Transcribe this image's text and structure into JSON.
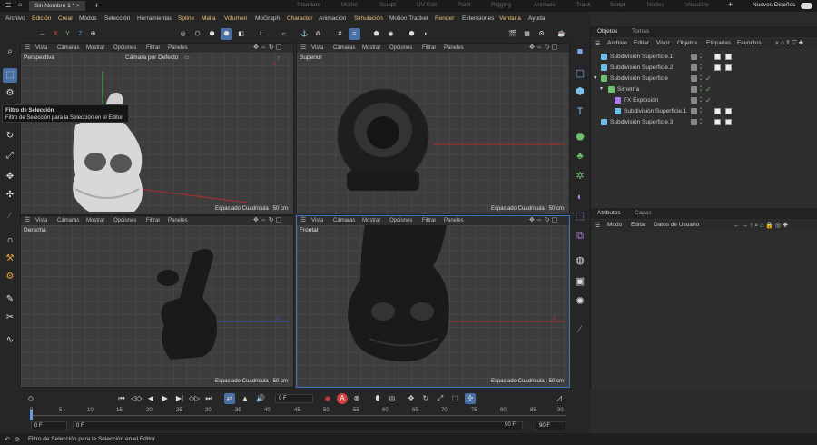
{
  "topbar": {
    "file_tab": "Sin Nombre 1 *",
    "layouts": [
      "Standard",
      "Model",
      "Sculpt",
      "UV Edit",
      "Paint",
      "Rigging",
      "Animate",
      "Track",
      "Script",
      "Nodes",
      "Visualize"
    ],
    "new_layouts": "Nuevos Diseños"
  },
  "menu": [
    "Archivo",
    "Edición",
    "Crear",
    "Modos",
    "Selección",
    "Herramientas",
    "Spline",
    "Malla",
    "Volumen",
    "MoGraph",
    "Character",
    "Animación",
    "Simulación",
    "Motion Tracker",
    "Render",
    "Extensiones",
    "Ventana",
    "Ayuda"
  ],
  "toolbar": {
    "x": "X",
    "y": "Y",
    "z": "Z"
  },
  "tooltip": {
    "title": "Filtro de Selección",
    "desc": "Filtro de Selección para la Selección en el Editor"
  },
  "viewport_menu": [
    "Vista",
    "Cámaras",
    "Mostrar",
    "Opciones",
    "Filtrar",
    "Paneles"
  ],
  "viewports": {
    "perspective": {
      "label": "Perspectiva",
      "camera": "Cámara por Defecto",
      "grid": "Espaciado Cuadrícula : 50 cm"
    },
    "top": {
      "label": "Superior",
      "grid": "Espaciado Cuadrícula : 50 cm"
    },
    "right": {
      "label": "Derecha",
      "grid": "Espaciado Cuadrícula : 50 cm"
    },
    "front": {
      "label": "Frontal",
      "grid": "Espaciado Cuadrícula : 50 cm"
    }
  },
  "objects_panel": {
    "tabs": [
      "Objetos",
      "Tomas"
    ],
    "menu": [
      "Archivo",
      "Editar",
      "Visor",
      "Objetos",
      "Etiquetas",
      "Favoritos"
    ],
    "rows": [
      {
        "name": "Subdivisión Superficie.1",
        "indent": 0
      },
      {
        "name": "Subdivisión Superficie.2",
        "indent": 0
      },
      {
        "name": "Subdivisión Superficie",
        "indent": 0
      },
      {
        "name": "Simetría",
        "indent": 1
      },
      {
        "name": "FX Explosión",
        "indent": 2
      },
      {
        "name": "Subdivisión Superficie.1",
        "indent": 2
      },
      {
        "name": "Subdivisión Superficie.3",
        "indent": 0
      }
    ]
  },
  "attributes_panel": {
    "tabs": [
      "Atributos",
      "Capas"
    ],
    "menu": [
      "Modo",
      "Editar",
      "Datos de Usuario"
    ]
  },
  "timeline": {
    "current_frame": "0 F",
    "ticks": [
      "0",
      "5",
      "10",
      "15",
      "20",
      "25",
      "30",
      "35",
      "40",
      "45",
      "50",
      "55",
      "60",
      "65",
      "70",
      "75",
      "80",
      "85",
      "90"
    ],
    "start": "0 F",
    "start2": "0 F",
    "end": "90 F",
    "end2": "90 F"
  },
  "status": "Filtro de Selección para la Selección en el Editor"
}
